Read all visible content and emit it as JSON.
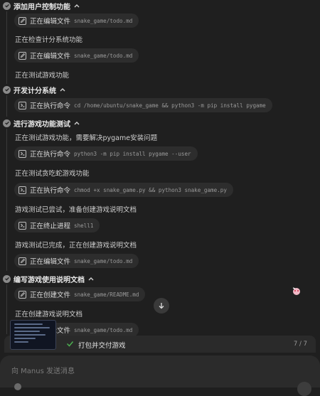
{
  "sections": [
    {
      "title": "添加用户控制功能"
    },
    {
      "title": "开发计分系统"
    },
    {
      "title": "进行游戏功能测试"
    },
    {
      "title": "编写游戏使用说明文档"
    }
  ],
  "steps": [
    {
      "label": "正在编辑文件",
      "detail": "snake_game/todo.md",
      "icon": "edit-file-icon"
    },
    {
      "text": "正在检查计分系统功能"
    },
    {
      "label": "正在编辑文件",
      "detail": "snake_game/todo.md",
      "icon": "edit-file-icon"
    },
    {
      "text": "正在测试游戏功能"
    },
    {
      "label": "正在执行命令",
      "detail": "cd /home/ubuntu/snake_game && python3 -m pip install pygame",
      "icon": "terminal-icon"
    },
    {
      "text": "正在测试游戏功能，需要解决pygame安装问题"
    },
    {
      "label": "正在执行命令",
      "detail": "python3 -m pip install pygame --user",
      "icon": "terminal-icon"
    },
    {
      "text": "正在测试贪吃蛇游戏功能"
    },
    {
      "label": "正在执行命令",
      "detail": "chmod +x snake_game.py && python3 snake_game.py",
      "icon": "terminal-icon"
    },
    {
      "text": "游戏测试已尝试，准备创建游戏说明文档"
    },
    {
      "label": "正在终止进程",
      "detail": "shell1",
      "icon": "terminal-icon"
    },
    {
      "text": "游戏测试已完成，正在创建游戏说明文档"
    },
    {
      "label": "正在编辑文件",
      "detail": "snake_game/todo.md",
      "icon": "edit-file-icon"
    },
    {
      "label": "正在创建文件",
      "detail": "snake_game/README.md",
      "icon": "edit-file-icon"
    },
    {
      "text": "正在创建游戏说明文档"
    },
    {
      "label": "正在编辑文件",
      "detail": "snake_game/todo.md",
      "icon": "edit-file-icon"
    }
  ],
  "progress": {
    "label": "打包并交付游戏",
    "count": "7 / 7",
    "fraction": 1.0
  },
  "input": {
    "placeholder": "向 Manus 发送消息"
  },
  "colors": {
    "background": "#1f1f1f",
    "pill": "#2d2d2d",
    "check_green": "#4caf50"
  }
}
